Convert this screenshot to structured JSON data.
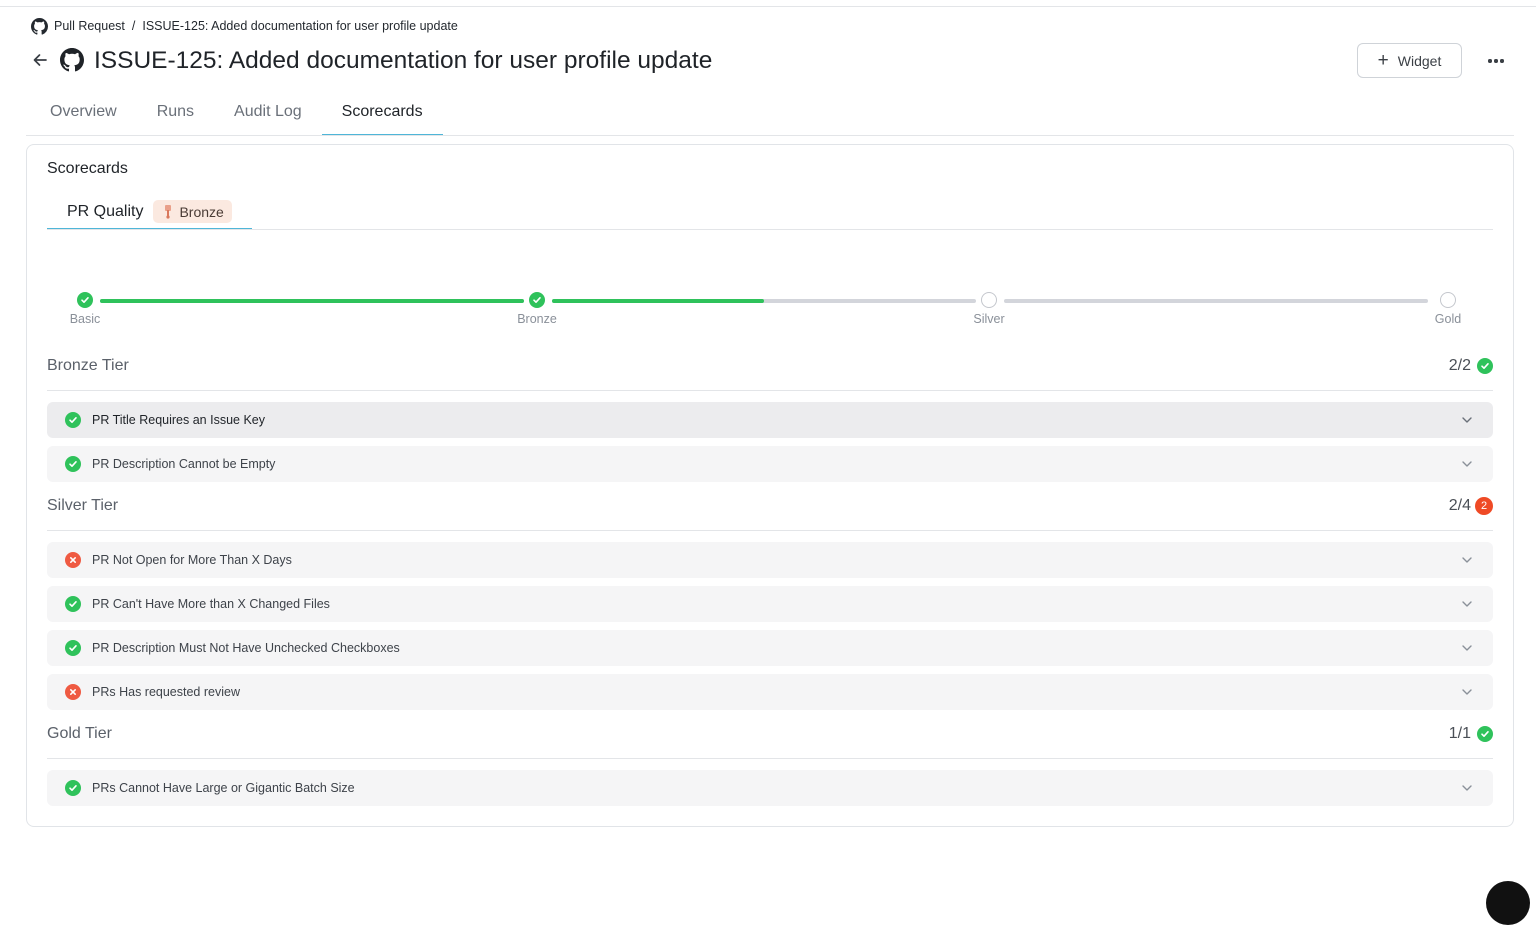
{
  "breadcrumb": {
    "root": "Pull Request",
    "separator": "/",
    "current": "ISSUE-125: Added documentation for user profile update"
  },
  "header": {
    "title": "ISSUE-125: Added documentation for user profile update",
    "widget_label": "Widget",
    "widget_icon": "plus-icon",
    "more_icon": "more-horizontal-icon",
    "entity_icon": "github-icon"
  },
  "tabs": [
    {
      "label": "Overview",
      "active": false
    },
    {
      "label": "Runs",
      "active": false
    },
    {
      "label": "Audit Log",
      "active": false
    },
    {
      "label": "Scorecards",
      "active": true
    }
  ],
  "scorecards": {
    "title": "Scorecards",
    "tab_label": "PR Quality",
    "level_badge": "Bronze",
    "progress": {
      "levels": [
        {
          "label": "Basic",
          "achieved": true
        },
        {
          "label": "Bronze",
          "achieved": true
        },
        {
          "label": "Silver",
          "achieved": false
        },
        {
          "label": "Gold",
          "achieved": false
        }
      ],
      "segment_fill": [
        1.0,
        0.5,
        0.0
      ]
    },
    "tiers": [
      {
        "name": "Bronze Tier",
        "score": "2/2",
        "status": "pass",
        "fail_count": null,
        "rules": [
          {
            "label": "PR Title Requires an Issue Key",
            "status": "pass",
            "highlighted": true
          },
          {
            "label": "PR Description Cannot be Empty",
            "status": "pass",
            "highlighted": false
          }
        ]
      },
      {
        "name": "Silver Tier",
        "score": "2/4",
        "status": "fail",
        "fail_count": "2",
        "rules": [
          {
            "label": "PR Not Open for More Than X Days",
            "status": "fail",
            "highlighted": false
          },
          {
            "label": "PR Can't Have More than X Changed Files",
            "status": "pass",
            "highlighted": false
          },
          {
            "label": "PR Description Must Not Have Unchecked Checkboxes",
            "status": "pass",
            "highlighted": false
          },
          {
            "label": "PRs Has requested review",
            "status": "fail",
            "highlighted": false
          }
        ]
      },
      {
        "name": "Gold Tier",
        "score": "1/1",
        "status": "pass",
        "fail_count": null,
        "rules": [
          {
            "label": "PRs Cannot Have Large or Gigantic Batch Size",
            "status": "pass",
            "highlighted": false
          }
        ]
      }
    ]
  },
  "colors": {
    "accent": "#4fb6d8",
    "pass": "#2fc25b",
    "fail": "#ef5a42",
    "badge_bg": "#fbe9e0"
  }
}
